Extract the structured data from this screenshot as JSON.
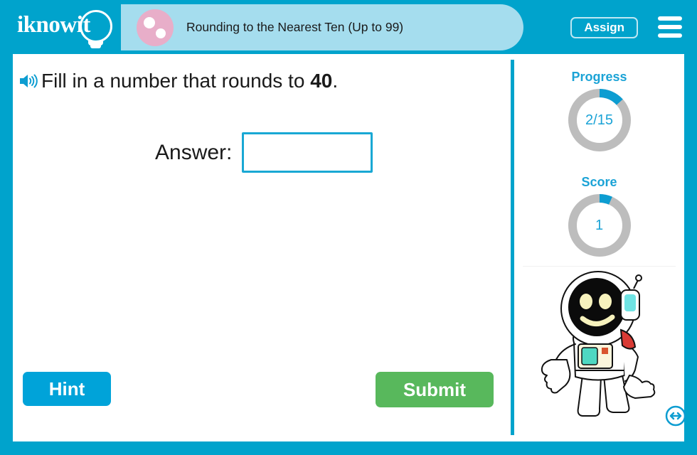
{
  "header": {
    "logo_text": "iknowit",
    "logo_icon": "lightbulb-icon",
    "title": "Rounding to the Nearest Ten (Up to 99)",
    "title_icon": "pink-dots-circle-icon",
    "assign_label": "Assign",
    "menu_icon": "hamburger-menu-icon"
  },
  "question": {
    "speaker_icon": "speaker-audio-icon",
    "prefix": "Fill in a number that rounds to ",
    "target_number": "40",
    "suffix": ".",
    "answer_label": "Answer:",
    "answer_value": "",
    "answer_placeholder": ""
  },
  "actions": {
    "hint_label": "Hint",
    "submit_label": "Submit"
  },
  "sidebar": {
    "progress": {
      "title": "Progress",
      "value_text": "2/15",
      "current": 2,
      "total": 15,
      "arc_degrees": 48
    },
    "score": {
      "title": "Score",
      "value_text": "1",
      "value": 1,
      "arc_degrees": 24
    },
    "mascot_icon": "astronaut-mascot",
    "resize_icon": "horizontal-resize-arrows-icon"
  },
  "colors": {
    "brand_cyan": "#00a3cc",
    "title_pill": "#a5ddee",
    "pink": "#e8aec9",
    "ring_track": "#bdbdbd",
    "ring_fill": "#1ba3d6",
    "submit_green": "#58b85c",
    "input_border": "#19a8d4"
  }
}
